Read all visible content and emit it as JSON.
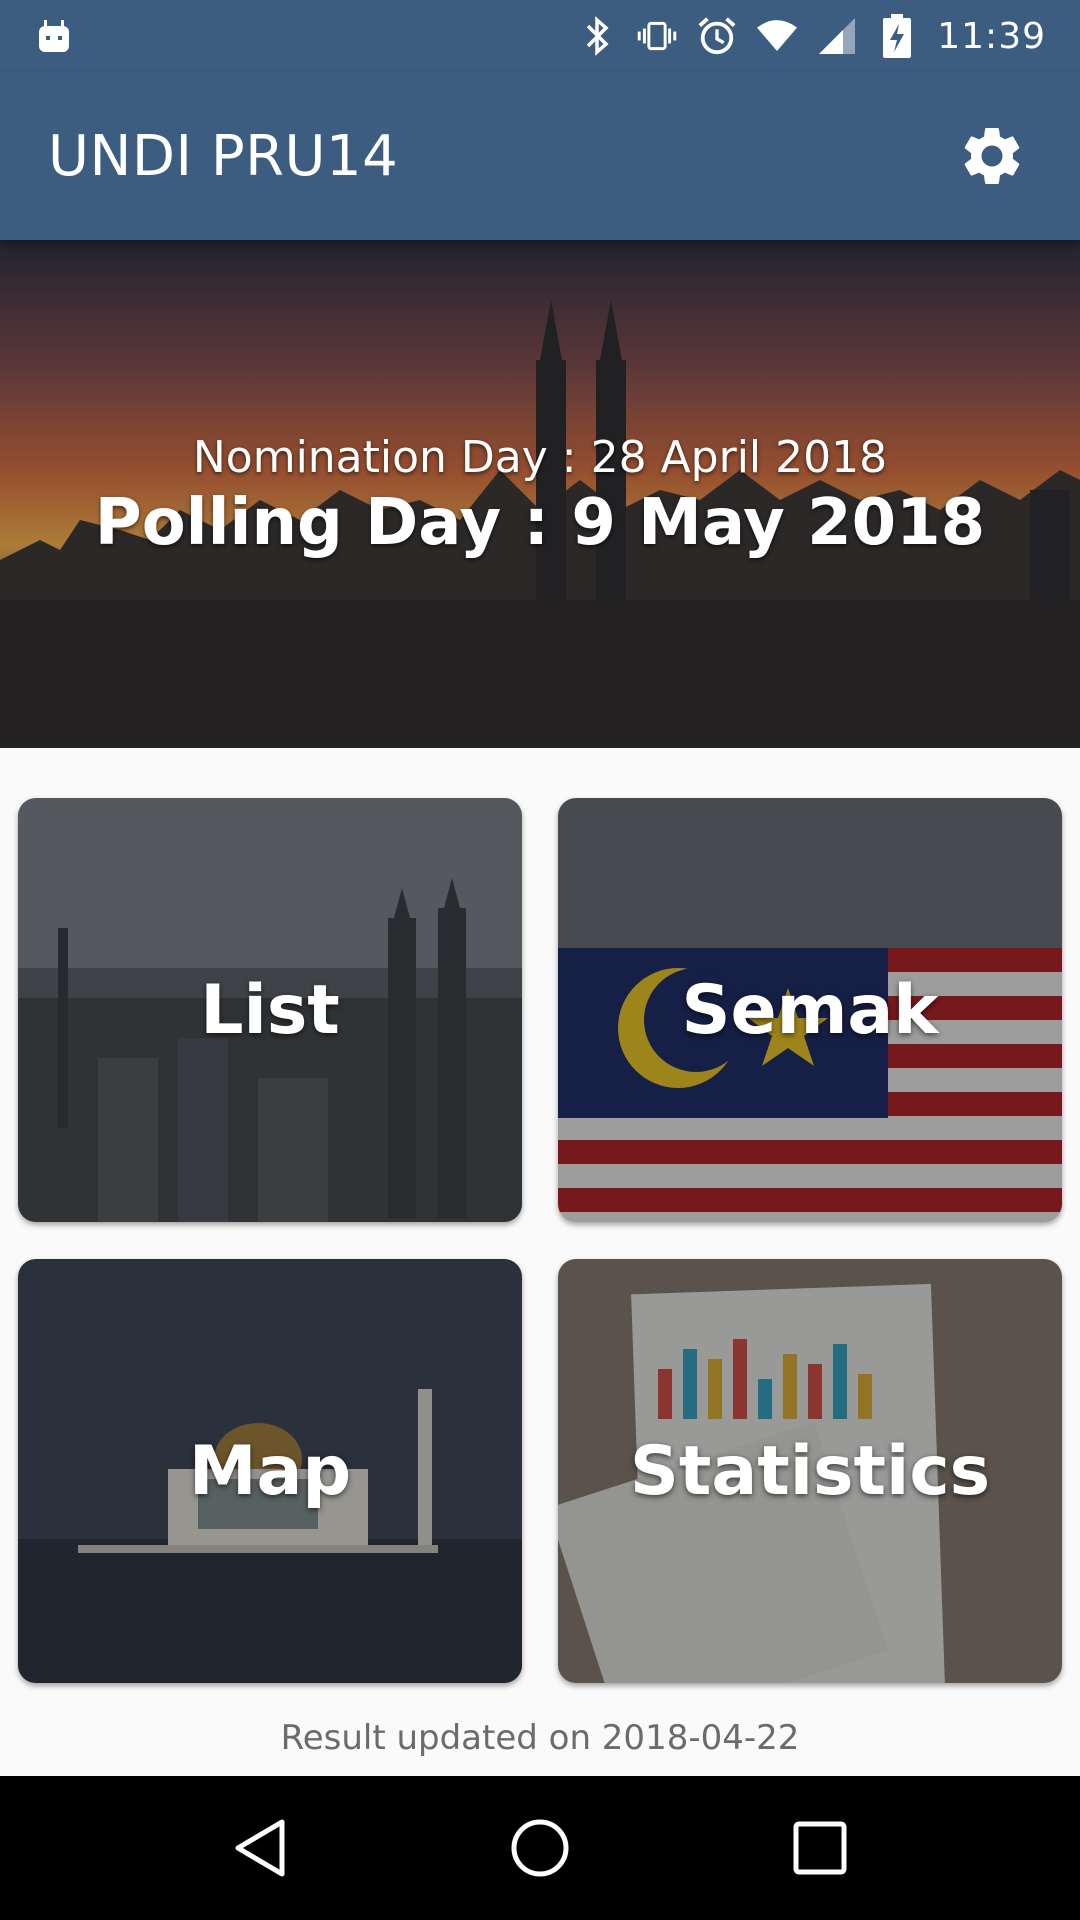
{
  "status_bar": {
    "time": "11:39",
    "icons": [
      "android-icon",
      "bluetooth-icon",
      "vibrate-icon",
      "alarm-icon",
      "wifi-icon",
      "signal-icon",
      "battery-charging-icon"
    ]
  },
  "app_bar": {
    "title": "UNDI PRU14",
    "settings_icon": "gear-icon"
  },
  "banner": {
    "nomination": "Nomination Day : 28 April 2018",
    "polling": "Polling Day : 9 May 2018"
  },
  "cards": {
    "list": "List",
    "semak": "Semak",
    "map": "Map",
    "statistics": "Statistics"
  },
  "footer": {
    "updated": "Result updated on 2018-04-22"
  },
  "nav_bar": {
    "icons": [
      "back-icon",
      "home-icon",
      "recents-icon"
    ]
  },
  "colors": {
    "primary": "#3c5d80",
    "background": "#fafafa",
    "nav": "#000000"
  }
}
